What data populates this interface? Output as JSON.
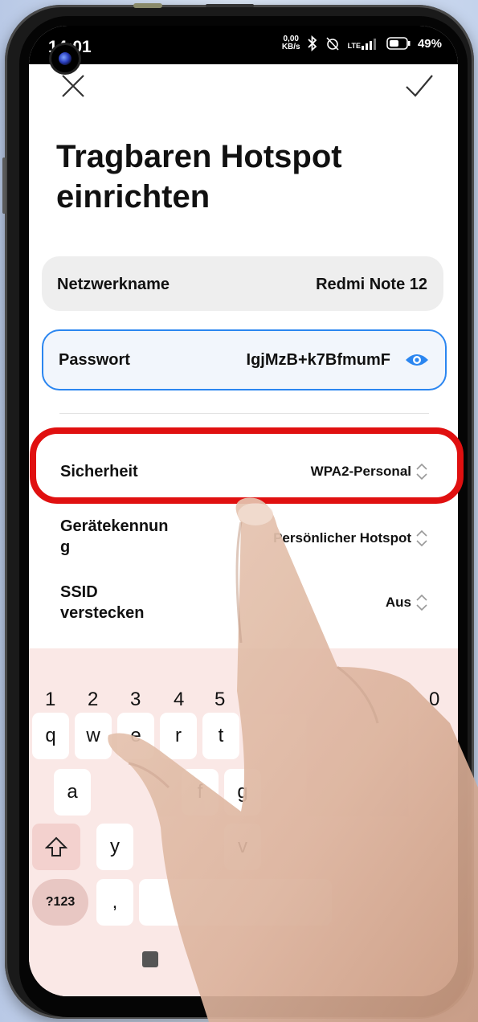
{
  "status_bar": {
    "time": "14:01",
    "net_speed_value": "0,00",
    "net_speed_unit": "KB/s",
    "lte": "LTE",
    "battery": "49%"
  },
  "header": {
    "close_icon": "close-icon",
    "confirm_icon": "check-icon",
    "title": "Tragbaren Hotspot einrichten"
  },
  "fields": {
    "network_name": {
      "label": "Netzwerkname",
      "value": "Redmi Note 12"
    },
    "password": {
      "label": "Passwort",
      "value": "IgjMzB+k7BfmumF",
      "icon": "eye-icon",
      "accent": "#2b86f0"
    }
  },
  "settings": [
    {
      "label": "Sicherheit",
      "value": "WPA2-Personal"
    },
    {
      "label": "Gerätekennun\ng",
      "value": "Persönlicher Hotspot"
    },
    {
      "label": "SSID\nverstecken",
      "value": "Aus"
    }
  ],
  "highlight_color": "#e01010",
  "keyboard": {
    "numbers": [
      "1",
      "2",
      "3",
      "4",
      "5",
      "0"
    ],
    "row1": [
      "q",
      "w",
      "e",
      "r",
      "t"
    ],
    "row2": [
      "a",
      "f",
      "g"
    ],
    "row3": [
      "y",
      "v"
    ],
    "shift_icon": "shift-icon",
    "symbols_label": "?123",
    "comma": ","
  }
}
